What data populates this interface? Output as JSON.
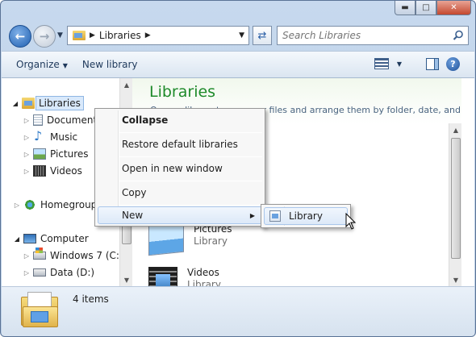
{
  "address": {
    "breadcrumb": "Libraries",
    "search_placeholder": "Search Libraries"
  },
  "toolbar": {
    "organize": "Organize",
    "new_library": "New library"
  },
  "nav": {
    "libraries": "Libraries",
    "documents": "Documents",
    "music": "Music",
    "pictures": "Pictures",
    "videos": "Videos",
    "homegroup": "Homegroup",
    "computer": "Computer",
    "drive_c": "Windows 7 (C:)",
    "drive_d": "Data (D:)"
  },
  "main": {
    "title": "Libraries",
    "subtitle": "Open a library to see your files and arrange them by folder, date, and...",
    "items": [
      {
        "name": "Pictures",
        "type": "Library"
      },
      {
        "name": "Videos",
        "type": "Library"
      }
    ]
  },
  "context_menu": {
    "collapse": "Collapse",
    "restore": "Restore default libraries",
    "open_new_window": "Open in new window",
    "copy": "Copy",
    "new": "New"
  },
  "submenu": {
    "library": "Library"
  },
  "status": {
    "count": "4 items"
  }
}
